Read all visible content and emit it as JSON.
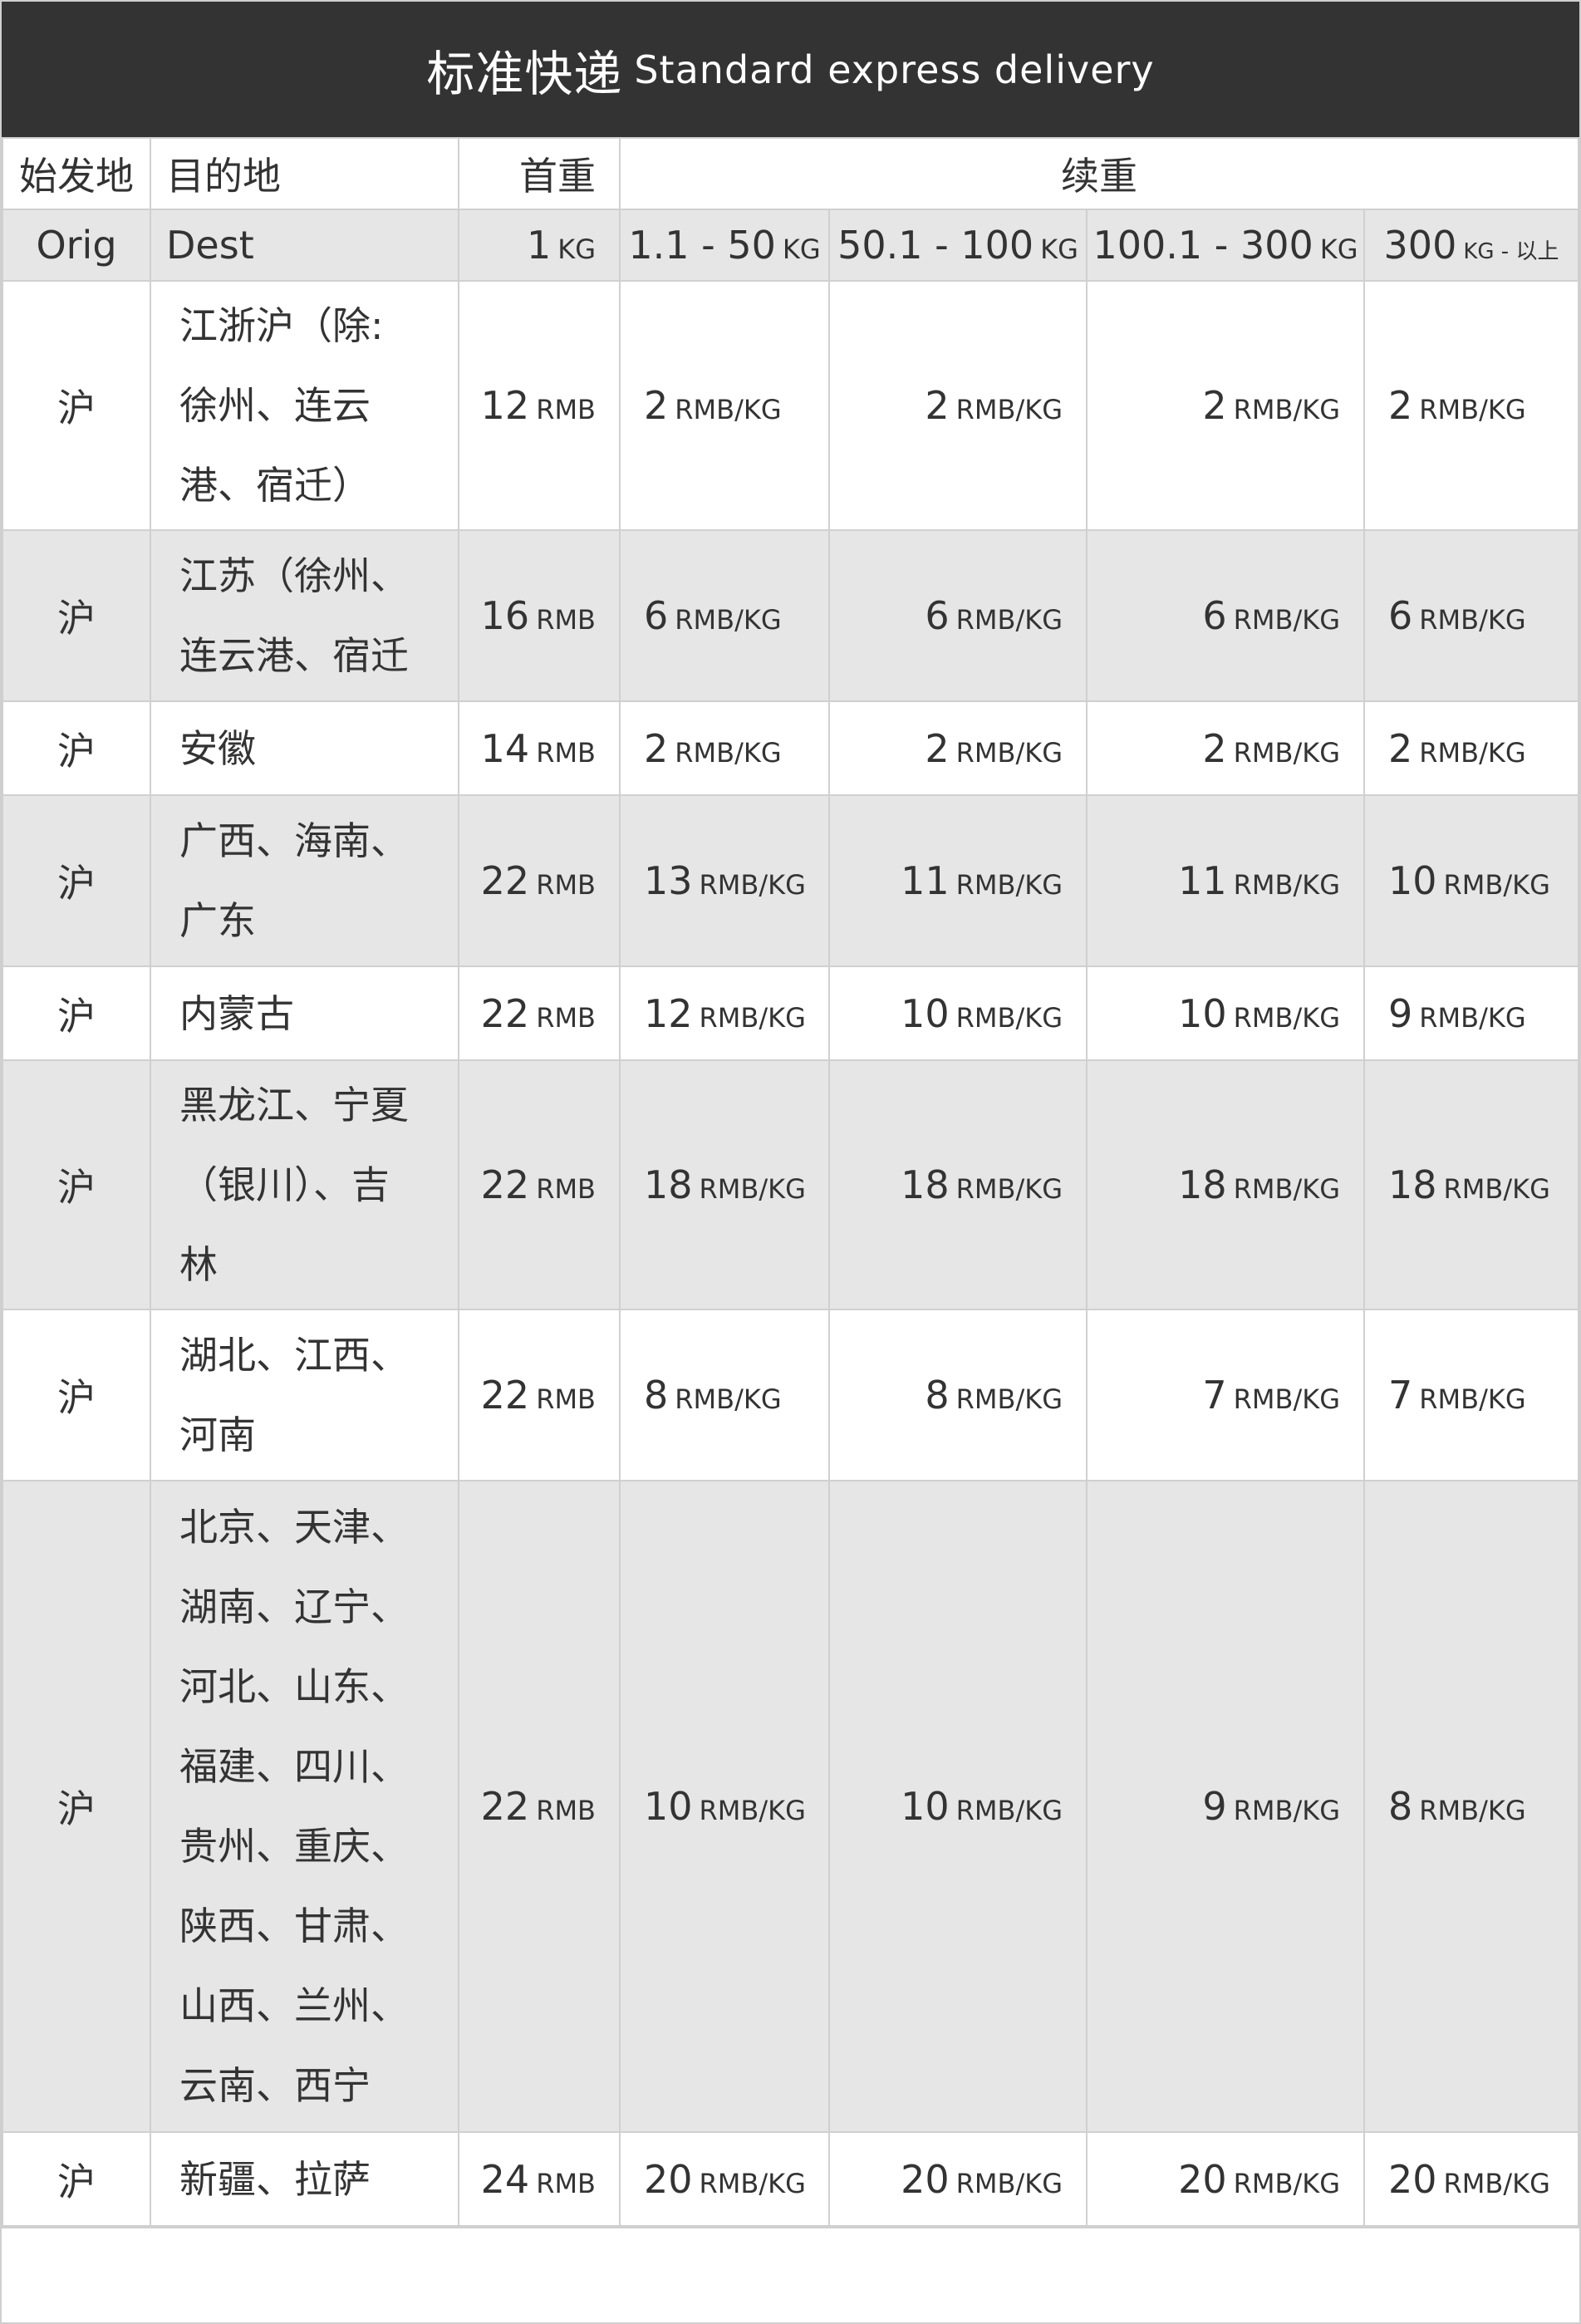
{
  "title": {
    "zh": "标准快递",
    "en": "Standard express delivery"
  },
  "header_zh": {
    "orig": "始发地",
    "dest": "目的地",
    "first": "首重",
    "extra": "续重"
  },
  "header_en": {
    "orig": "Orig",
    "dest": "Dest",
    "first_num": "1",
    "first_unit": "KG",
    "w1_num": "1.1 - 50",
    "w1_unit": "KG",
    "w2_num": "50.1 - 100",
    "w2_unit": "KG",
    "w3_num": "100.1 - 300",
    "w3_unit": "KG",
    "w4_num": "300",
    "w4_unit": "KG - 以上"
  },
  "units": {
    "first": "RMB",
    "extra": "RMB/KG"
  },
  "rows": [
    {
      "orig": "沪",
      "dest": [
        "江浙沪（除:",
        "徐州、连云",
        "港、宿迁）"
      ],
      "first": "12",
      "w1": "2",
      "w2": "2",
      "w3": "2",
      "w4": "2"
    },
    {
      "orig": "沪",
      "dest": [
        "江苏（徐州、",
        "连云港、宿迁"
      ],
      "first": "16",
      "w1": "6",
      "w2": "6",
      "w3": "6",
      "w4": "6"
    },
    {
      "orig": "沪",
      "dest": [
        "安徽"
      ],
      "first": "14",
      "w1": "2",
      "w2": "2",
      "w3": "2",
      "w4": "2"
    },
    {
      "orig": "沪",
      "dest": [
        "广西、海南、",
        "广东"
      ],
      "first": "22",
      "w1": "13",
      "w2": "11",
      "w3": "11",
      "w4": "10"
    },
    {
      "orig": "沪",
      "dest": [
        "内蒙古"
      ],
      "first": "22",
      "w1": "12",
      "w2": "10",
      "w3": "10",
      "w4": "9"
    },
    {
      "orig": "沪",
      "dest": [
        "黑龙江、宁夏",
        "（银川）、吉",
        "林"
      ],
      "first": "22",
      "w1": "18",
      "w2": "18",
      "w3": "18",
      "w4": "18"
    },
    {
      "orig": "沪",
      "dest": [
        "湖北、江西、",
        "河南"
      ],
      "first": "22",
      "w1": "8",
      "w2": "8",
      "w3": "7",
      "w4": "7"
    },
    {
      "orig": "沪",
      "dest": [
        "北京、天津、",
        "湖南、辽宁、",
        "河北、山东、",
        "福建、四川、",
        "贵州、重庆、",
        "陕西、甘肃、",
        "山西、兰州、",
        "云南、西宁"
      ],
      "first": "22",
      "w1": "10",
      "w2": "10",
      "w3": "9",
      "w4": "8"
    },
    {
      "orig": "沪",
      "dest": [
        "新疆、拉萨"
      ],
      "first": "24",
      "w1": "20",
      "w2": "20",
      "w3": "20",
      "w4": "20"
    }
  ]
}
